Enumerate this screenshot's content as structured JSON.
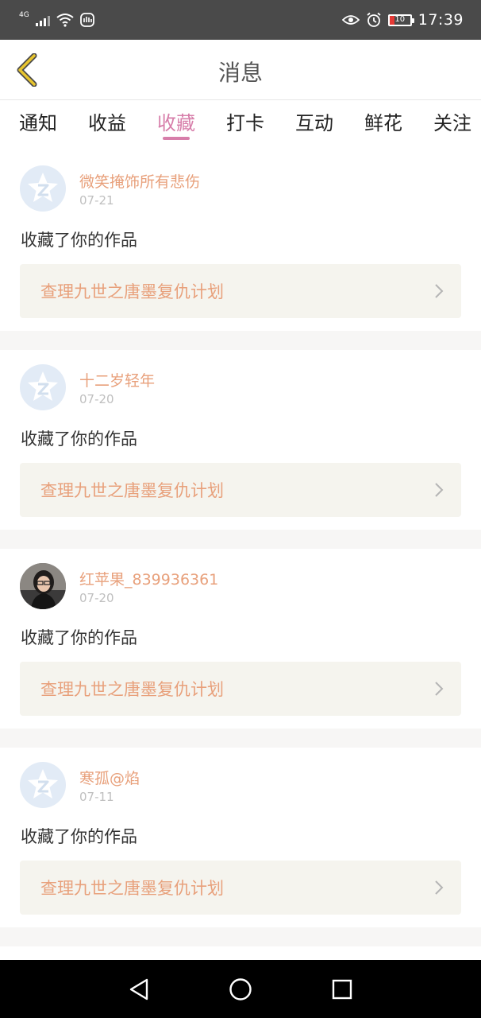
{
  "status_bar": {
    "network": "4G",
    "battery": "10",
    "time": "17:39"
  },
  "header": {
    "title": "消息"
  },
  "tabs": [
    {
      "label": "通知",
      "active": false
    },
    {
      "label": "收益",
      "active": false
    },
    {
      "label": "收藏",
      "active": true
    },
    {
      "label": "打卡",
      "active": false
    },
    {
      "label": "互动",
      "active": false
    },
    {
      "label": "鲜花",
      "active": false
    },
    {
      "label": "关注",
      "active": false
    }
  ],
  "notifications": [
    {
      "user": "微笑掩饰所有悲伤",
      "date": "07-21",
      "action": "收藏了你的作品",
      "work": "查理九世之唐墨复仇计划",
      "avatar": "default-avatar-icon"
    },
    {
      "user": "十二岁轻年",
      "date": "07-20",
      "action": "收藏了你的作品",
      "work": "查理九世之唐墨复仇计划",
      "avatar": "default-avatar-icon"
    },
    {
      "user": "红苹果_839936361",
      "date": "07-20",
      "action": "收藏了你的作品",
      "work": "查理九世之唐墨复仇计划",
      "avatar": "user-photo-avatar"
    },
    {
      "user": "寒孤@焰",
      "date": "07-11",
      "action": "收藏了你的作品",
      "work": "查理九世之唐墨复仇计划",
      "avatar": "default-avatar-icon"
    }
  ],
  "colors": {
    "accent_pink": "#d77eaa",
    "name_orange": "#e8a07b",
    "card_bg": "#f5f4ee",
    "back_arrow": "#e8c52e"
  }
}
